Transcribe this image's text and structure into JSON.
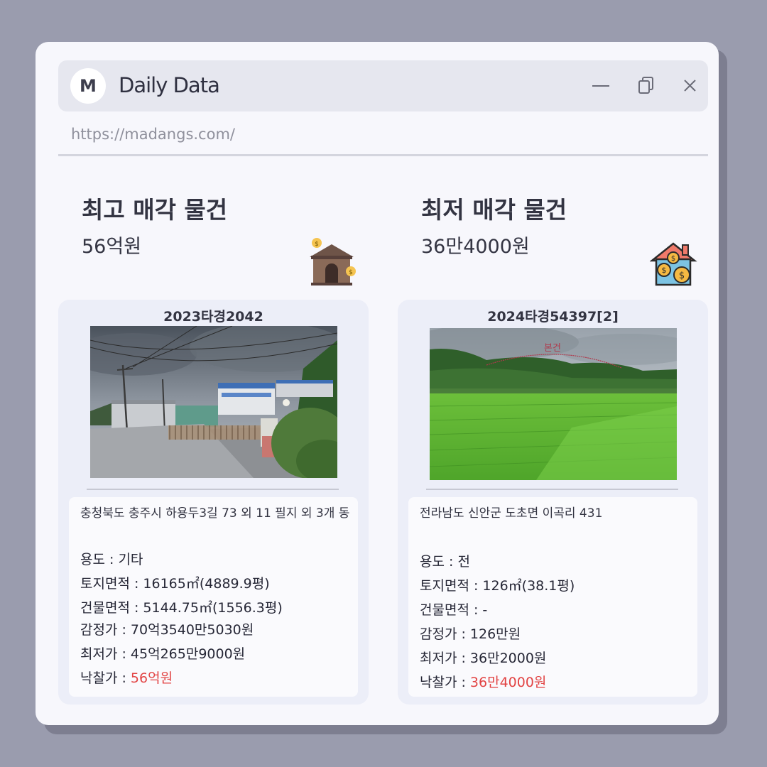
{
  "window": {
    "logo_letter": "M",
    "title": "Daily Data",
    "url": "https://madangs.com/"
  },
  "highest": {
    "heading": "최고 매각 물건",
    "amount": "56억원",
    "icon": "house-coin-icon",
    "card": {
      "case_no": "2023타경2042",
      "photo": "factory-road-photo",
      "address": "충청북도 충주시 하용두3길 73 외 11 필지 외 3개 동",
      "rows": {
        "usage_label": "용도 : ",
        "usage": "기타",
        "land_label": "토지면적 : ",
        "land": "16165㎡(4889.9평)",
        "building_label": "건물면적 : ",
        "building": "5144.75㎡(1556.3평)",
        "appraisal_label": "감정가 : ",
        "appraisal": "70억3540만5030원",
        "minimum_label": "최저가 : ",
        "minimum": "45억265만9000원",
        "winning_label": "낙찰가 : ",
        "winning": "56억원"
      }
    }
  },
  "lowest": {
    "heading": "최저 매각 물건",
    "amount": "36만4000원",
    "icon": "house-money-icon",
    "card": {
      "case_no": "2024타경54397[2]",
      "photo": "rice-field-photo",
      "photo_label": "본건",
      "address": "전라남도 신안군 도초면 이곡리 431",
      "rows": {
        "usage_label": "용도 : ",
        "usage": "전",
        "land_label": "토지면적 : ",
        "land": "126㎡(38.1평)",
        "building_label": "건물면적 : ",
        "building": "-",
        "appraisal_label": "감정가 : ",
        "appraisal": "126만원",
        "minimum_label": "최저가 : ",
        "minimum": "36만2000원",
        "winning_label": "낙찰가 : ",
        "winning": "36만4000원"
      }
    }
  },
  "colors": {
    "background": "#9a9cae",
    "window": "#f7f7fc",
    "card": "#eceef8",
    "highlight": "#e24343"
  }
}
